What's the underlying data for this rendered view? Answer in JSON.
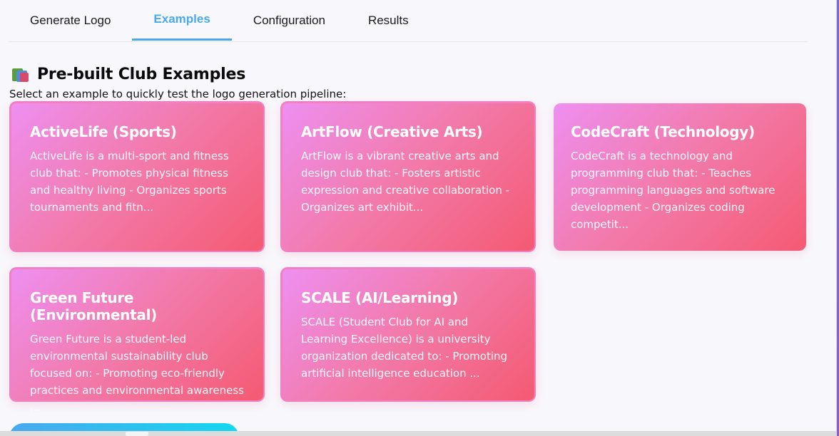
{
  "tabs": [
    {
      "label": "Generate Logo"
    },
    {
      "label": "Examples"
    },
    {
      "label": "Configuration"
    },
    {
      "label": "Results"
    }
  ],
  "active_tab": "Examples",
  "section": {
    "icon": "books-icon",
    "title": "Pre-built Club Examples",
    "subtitle": "Select an example to quickly test the logo generation pipeline:"
  },
  "examples": [
    {
      "title": "ActiveLife (Sports)",
      "description": "ActiveLife is a multi-sport and fitness club that: - Promotes physical fitness and healthy living - Organizes sports tournaments and fitn..."
    },
    {
      "title": "ArtFlow (Creative Arts)",
      "description": "ArtFlow is a vibrant creative arts and design club that: - Fosters artistic expression and creative collaboration - Organizes art exhibit..."
    },
    {
      "title": "CodeCraft (Technology)",
      "description": "CodeCraft is a technology and programming club that: - Teaches programming languages and software development - Organizes coding competit..."
    },
    {
      "title": "Green Future (Environmental)",
      "description": "Green Future is a student-led environmental sustainability club focused on: - Promoting eco-friendly practices and environmental awareness ..."
    },
    {
      "title": "SCALE (AI/Learning)",
      "description": "SCALE (Student Club for AI and Learning Excellence) is a university organization dedicated to: - Promoting artificial intelligence education ..."
    }
  ],
  "colors": {
    "accent": "#4aa8ef",
    "card_gradient_start": "#ee8ff1",
    "card_gradient_end": "#f45a72"
  }
}
